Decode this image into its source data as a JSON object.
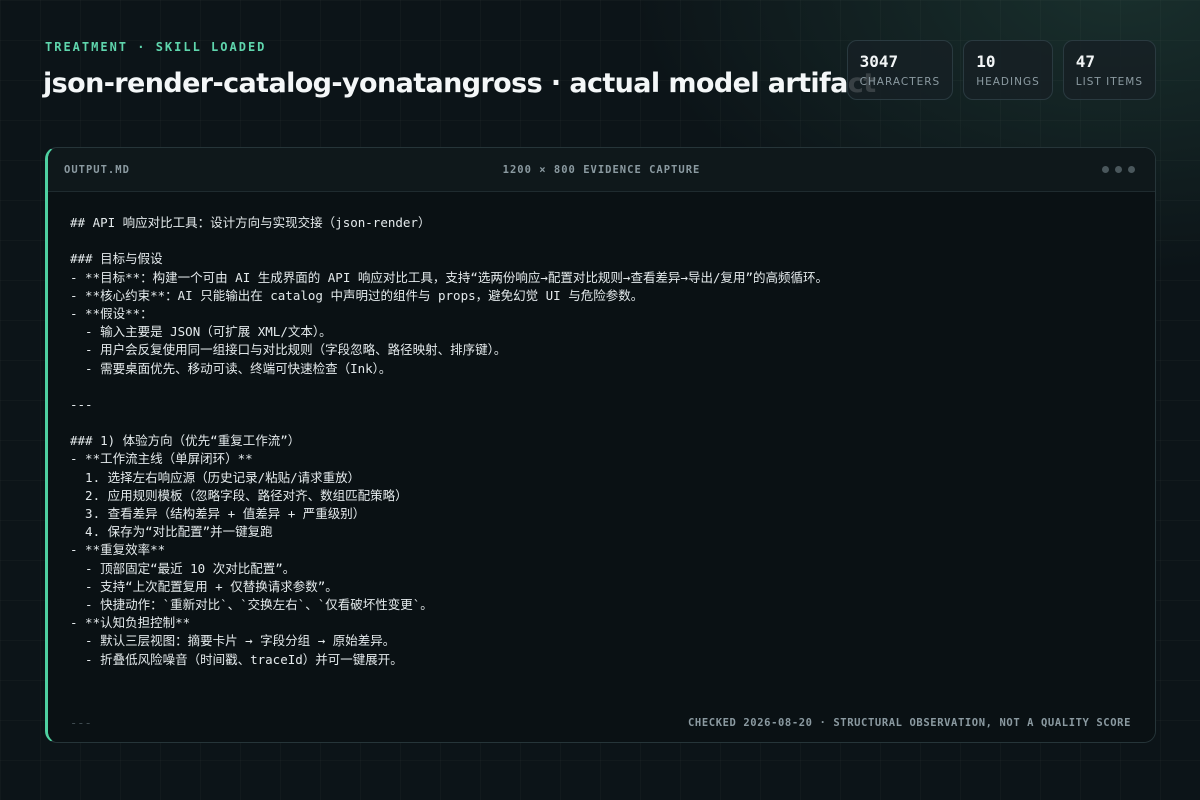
{
  "header": {
    "kicker": "TREATMENT · SKILL LOADED",
    "title": "json-render-catalog-yonatangross · actual model artifact"
  },
  "stats": [
    {
      "value": "3047",
      "label": "CHARACTERS"
    },
    {
      "value": "10",
      "label": "HEADINGS"
    },
    {
      "value": "47",
      "label": "LIST ITEMS"
    }
  ],
  "panel": {
    "filename": "OUTPUT.MD",
    "caption": "1200 × 800 EVIDENCE CAPTURE",
    "lines": [
      "## API 响应对比工具：设计方向与实现交接（json-render）",
      "",
      "### 目标与假设",
      "- **目标**：构建一个可由 AI 生成界面的 API 响应对比工具，支持“选两份响应→配置对比规则→查看差异→导出/复用”的高频循环。",
      "- **核心约束**：AI 只能输出在 catalog 中声明过的组件与 props，避免幻觉 UI 与危险参数。",
      "- **假设**：",
      "  - 输入主要是 JSON（可扩展 XML/文本）。",
      "  - 用户会反复使用同一组接口与对比规则（字段忽略、路径映射、排序键）。",
      "  - 需要桌面优先、移动可读、终端可快速检查（Ink）。",
      "",
      "---",
      "",
      "### 1) 体验方向（优先“重复工作流”）",
      "- **工作流主线（单屏闭环）**",
      "  1. 选择左右响应源（历史记录/粘贴/请求重放）",
      "  2. 应用规则模板（忽略字段、路径对齐、数组匹配策略）",
      "  3. 查看差异（结构差异 + 值差异 + 严重级别）",
      "  4. 保存为“对比配置”并一键复跑",
      "- **重复效率**",
      "  - 顶部固定“最近 10 次对比配置”。",
      "  - 支持“上次配置复用 + 仅替换请求参数”。",
      "  - 快捷动作：`重新对比`、`交换左右`、`仅看破坏性变更`。",
      "- **认知负担控制**",
      "  - 默认三层视图：摘要卡片 → 字段分组 → 原始差异。",
      "  - 折叠低风险噪音（时间戳、traceId）并可一键展开。"
    ],
    "footer_left": "---",
    "footer_note": "CHECKED 2026-08-20 · STRUCTURAL OBSERVATION, NOT A QUALITY SCORE"
  }
}
